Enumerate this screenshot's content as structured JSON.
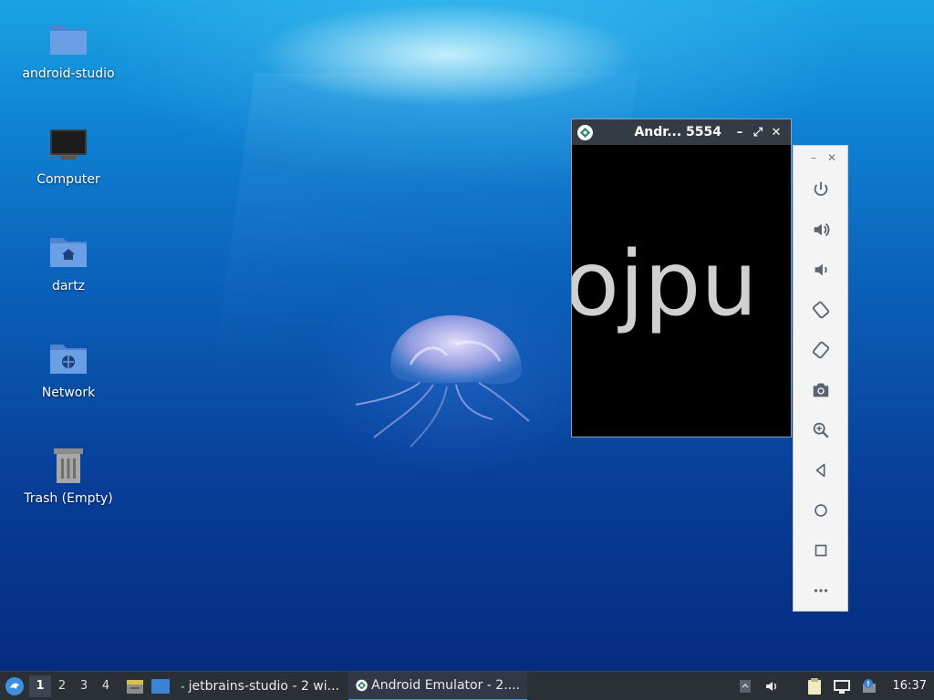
{
  "desktop": {
    "icons": [
      {
        "label": "android-studio",
        "icon": "folder-icon"
      },
      {
        "label": "Computer",
        "icon": "monitor-icon"
      },
      {
        "label": "dartz",
        "icon": "home-folder-icon"
      },
      {
        "label": "Network",
        "icon": "network-folder-icon"
      },
      {
        "label": "Trash (Empty)",
        "icon": "trash-icon"
      }
    ]
  },
  "emulator_window": {
    "title": "Andr... 5554",
    "minimize": "–",
    "maximize": "⤢",
    "close": "✕",
    "screen_text": "ojpu"
  },
  "emulator_toolbar": {
    "minimize": "–",
    "close": "✕",
    "buttons": [
      "power-icon",
      "volume-up-icon",
      "volume-down-icon",
      "rotate-left-icon",
      "rotate-right-icon",
      "camera-icon",
      "zoom-icon",
      "back-icon",
      "home-icon",
      "overview-icon",
      "more-icon"
    ]
  },
  "taskbar": {
    "workspaces": [
      "1",
      "2",
      "3",
      "4"
    ],
    "active_workspace": "1",
    "tasks": [
      {
        "label": "jetbrains-studio - 2 wi...",
        "icon": "android-icon"
      },
      {
        "label": "Android Emulator - 2....",
        "icon": "emulator-icon"
      }
    ],
    "clock": "16:37"
  },
  "colors": {
    "taskbar_bg": "#2b2f36",
    "accent": "#4a90e2",
    "folder_blue": "#5b8fd8"
  }
}
